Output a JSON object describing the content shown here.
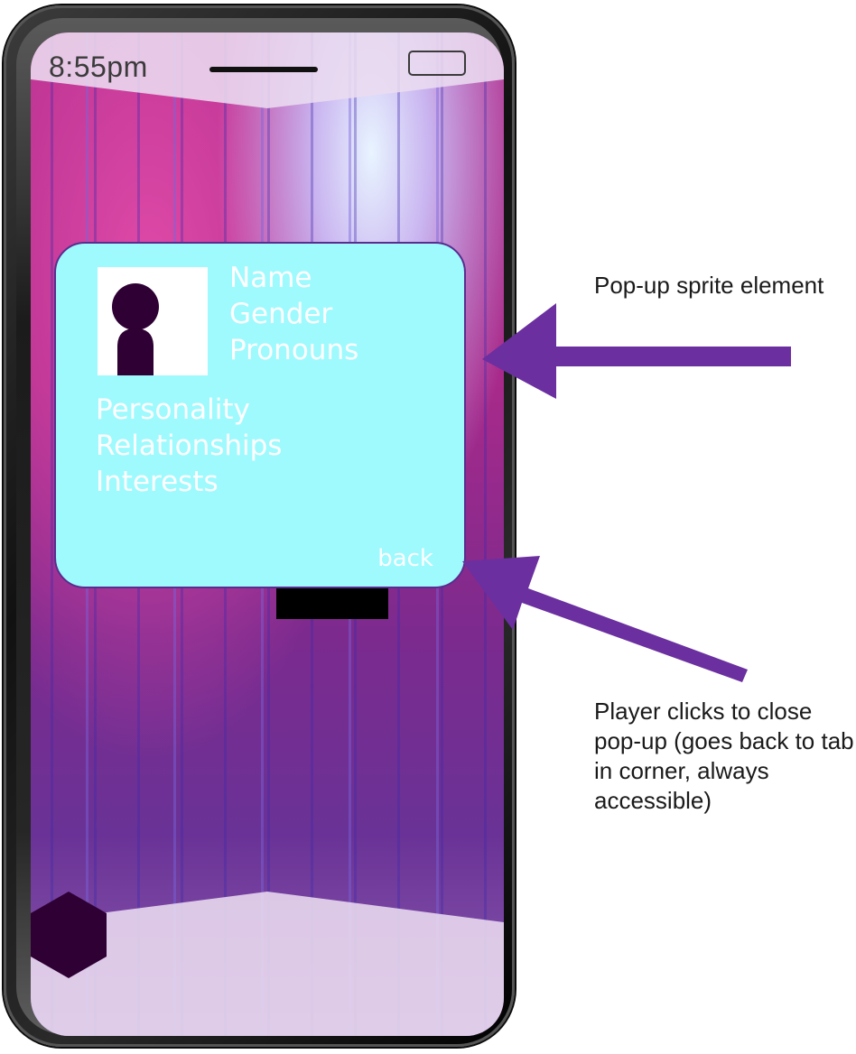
{
  "status_bar": {
    "time": "8:55pm"
  },
  "profile_card": {
    "name_label": "Name",
    "gender_label": "Gender",
    "pronouns_label": "Pronouns",
    "personality_label": "Personality",
    "relationships_label": "Relationships",
    "interests_label": "Interests",
    "back_label": "back"
  },
  "annotations": {
    "popup_note": "Pop-up sprite element",
    "back_note": "Player clicks to close pop-up (goes back to tab in corner, always accessible)"
  },
  "colors": {
    "card_background": "#9ffafe",
    "accent_purple": "#5a2c8e",
    "dark_plum": "#2e0033",
    "arrow": "#6b2fa0"
  },
  "icons": {
    "avatar": "person-silhouette-icon",
    "home": "hexagon-home-icon",
    "battery": "battery-icon"
  }
}
